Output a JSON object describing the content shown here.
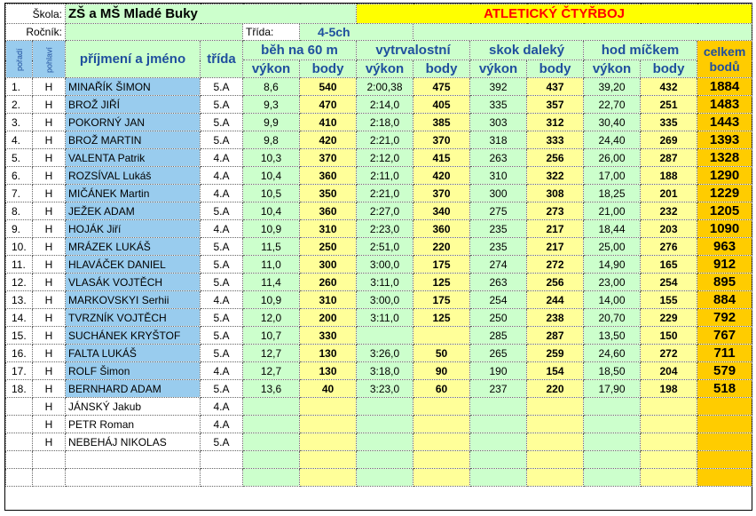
{
  "header": {
    "school_label": "Škola:",
    "school_value": "ZŠ a MŠ Mladé Buky",
    "title": "ATLETICKÝ ČTYŘBOJ",
    "grade_label": "Ročník:",
    "class_label": "Třída:",
    "class_value": "4-5ch"
  },
  "columns": {
    "rank": "pořadí",
    "gender": "pohlaví",
    "name": "příjmení a jméno",
    "class": "třída",
    "run60": "běh na 60 m",
    "endurance": "vytrvalostní",
    "longjump": "skok daleký",
    "throw": "hod míčkem",
    "total_line1": "celkem",
    "total_line2": "bodů",
    "performance": "výkon",
    "points": "body"
  },
  "rows": [
    {
      "rank": "1.",
      "gender": "H",
      "name": "MINAŘÍK ŠIMON",
      "class": "5.A",
      "run_perf": "8,6",
      "run_pts": "540",
      "end_perf": "2:00,38",
      "end_pts": "475",
      "jump_perf": "392",
      "jump_pts": "437",
      "throw_perf": "39,20",
      "throw_pts": "432",
      "total": "1884"
    },
    {
      "rank": "2.",
      "gender": "H",
      "name": "BROŽ JIŘÍ",
      "class": "5.A",
      "run_perf": "9,3",
      "run_pts": "470",
      "end_perf": "2:14,0",
      "end_pts": "405",
      "jump_perf": "335",
      "jump_pts": "357",
      "throw_perf": "22,70",
      "throw_pts": "251",
      "total": "1483"
    },
    {
      "rank": "3.",
      "gender": "H",
      "name": "POKORNÝ JAN",
      "class": "5.A",
      "run_perf": "9,9",
      "run_pts": "410",
      "end_perf": "2:18,0",
      "end_pts": "385",
      "jump_perf": "303",
      "jump_pts": "312",
      "throw_perf": "30,40",
      "throw_pts": "335",
      "total": "1443"
    },
    {
      "rank": "4.",
      "gender": "H",
      "name": "BROŽ MARTIN",
      "class": "5.A",
      "run_perf": "9,8",
      "run_pts": "420",
      "end_perf": "2:21,0",
      "end_pts": "370",
      "jump_perf": "318",
      "jump_pts": "333",
      "throw_perf": "24,40",
      "throw_pts": "269",
      "total": "1393"
    },
    {
      "rank": "5.",
      "gender": "H",
      "name": "VALENTA Patrik",
      "class": "4.A",
      "run_perf": "10,3",
      "run_pts": "370",
      "end_perf": "2:12,0",
      "end_pts": "415",
      "jump_perf": "263",
      "jump_pts": "256",
      "throw_perf": "26,00",
      "throw_pts": "287",
      "total": "1328"
    },
    {
      "rank": "6.",
      "gender": "H",
      "name": "ROZSÍVAL Lukáš",
      "class": "4.A",
      "run_perf": "10,4",
      "run_pts": "360",
      "end_perf": "2:11,0",
      "end_pts": "420",
      "jump_perf": "310",
      "jump_pts": "322",
      "throw_perf": "17,00",
      "throw_pts": "188",
      "total": "1290"
    },
    {
      "rank": "7.",
      "gender": "H",
      "name": "MIČÁNEK Martin",
      "class": "4.A",
      "run_perf": "10,5",
      "run_pts": "350",
      "end_perf": "2:21,0",
      "end_pts": "370",
      "jump_perf": "300",
      "jump_pts": "308",
      "throw_perf": "18,25",
      "throw_pts": "201",
      "total": "1229"
    },
    {
      "rank": "8.",
      "gender": "H",
      "name": "JEŽEK ADAM",
      "class": "5.A",
      "run_perf": "10,4",
      "run_pts": "360",
      "end_perf": "2:27,0",
      "end_pts": "340",
      "jump_perf": "275",
      "jump_pts": "273",
      "throw_perf": "21,00",
      "throw_pts": "232",
      "total": "1205"
    },
    {
      "rank": "9.",
      "gender": "H",
      "name": "HOJÁK Jiří",
      "class": "4.A",
      "run_perf": "10,9",
      "run_pts": "310",
      "end_perf": "2:23,0",
      "end_pts": "360",
      "jump_perf": "235",
      "jump_pts": "217",
      "throw_perf": "18,44",
      "throw_pts": "203",
      "total": "1090"
    },
    {
      "rank": "10.",
      "gender": "H",
      "name": "MRÁZEK LUKÁŠ",
      "class": "5.A",
      "run_perf": "11,5",
      "run_pts": "250",
      "end_perf": "2:51,0",
      "end_pts": "220",
      "jump_perf": "235",
      "jump_pts": "217",
      "throw_perf": "25,00",
      "throw_pts": "276",
      "total": "963"
    },
    {
      "rank": "11.",
      "gender": "H",
      "name": "HLAVÁČEK DANIEL",
      "class": "5.A",
      "run_perf": "11,0",
      "run_pts": "300",
      "end_perf": "3:00,0",
      "end_pts": "175",
      "jump_perf": "274",
      "jump_pts": "272",
      "throw_perf": "14,90",
      "throw_pts": "165",
      "total": "912"
    },
    {
      "rank": "12.",
      "gender": "H",
      "name": "VLASÁK VOJTĚCH",
      "class": "5.A",
      "run_perf": "11,4",
      "run_pts": "260",
      "end_perf": "3:11,0",
      "end_pts": "125",
      "jump_perf": "263",
      "jump_pts": "256",
      "throw_perf": "23,00",
      "throw_pts": "254",
      "total": "895"
    },
    {
      "rank": "13.",
      "gender": "H",
      "name": "MARKOVSKYI Serhii",
      "class": "4.A",
      "run_perf": "10,9",
      "run_pts": "310",
      "end_perf": "3:00,0",
      "end_pts": "175",
      "jump_perf": "254",
      "jump_pts": "244",
      "throw_perf": "14,00",
      "throw_pts": "155",
      "total": "884"
    },
    {
      "rank": "14.",
      "gender": "H",
      "name": "TVRZNÍK VOJTĚCH",
      "class": "5.A",
      "run_perf": "12,0",
      "run_pts": "200",
      "end_perf": "3:11,0",
      "end_pts": "125",
      "jump_perf": "250",
      "jump_pts": "238",
      "throw_perf": "20,70",
      "throw_pts": "229",
      "total": "792"
    },
    {
      "rank": "15.",
      "gender": "H",
      "name": "SUCHÁNEK KRYŠTOF",
      "class": "5.A",
      "run_perf": "10,7",
      "run_pts": "330",
      "end_perf": "",
      "end_pts": "",
      "jump_perf": "285",
      "jump_pts": "287",
      "throw_perf": "13,50",
      "throw_pts": "150",
      "total": "767"
    },
    {
      "rank": "16.",
      "gender": "H",
      "name": "FALTA LUKÁŠ",
      "class": "5.A",
      "run_perf": "12,7",
      "run_pts": "130",
      "end_perf": "3:26,0",
      "end_pts": "50",
      "jump_perf": "265",
      "jump_pts": "259",
      "throw_perf": "24,60",
      "throw_pts": "272",
      "total": "711"
    },
    {
      "rank": "17.",
      "gender": "H",
      "name": "ROLF Šimon",
      "class": "4.A",
      "run_perf": "12,7",
      "run_pts": "130",
      "end_perf": "3:18,0",
      "end_pts": "90",
      "jump_perf": "190",
      "jump_pts": "154",
      "throw_perf": "18,50",
      "throw_pts": "204",
      "total": "579"
    },
    {
      "rank": "18.",
      "gender": "H",
      "name": "BERNHARD ADAM",
      "class": "5.A",
      "run_perf": "13,6",
      "run_pts": "40",
      "end_perf": "3:23,0",
      "end_pts": "60",
      "jump_perf": "237",
      "jump_pts": "220",
      "throw_perf": "17,90",
      "throw_pts": "198",
      "total": "518"
    },
    {
      "rank": "",
      "gender": "H",
      "name": "JÁNSKÝ Jakub",
      "class": "4.A",
      "run_perf": "",
      "run_pts": "",
      "end_perf": "",
      "end_pts": "",
      "jump_perf": "",
      "jump_pts": "",
      "throw_perf": "",
      "throw_pts": "",
      "total": ""
    },
    {
      "rank": "",
      "gender": "H",
      "name": "PETR Roman",
      "class": "4.A",
      "run_perf": "",
      "run_pts": "",
      "end_perf": "",
      "end_pts": "",
      "jump_perf": "",
      "jump_pts": "",
      "throw_perf": "",
      "throw_pts": "",
      "total": ""
    },
    {
      "rank": "",
      "gender": "H",
      "name": "NEBEHÁJ NIKOLAS",
      "class": "5.A",
      "run_perf": "",
      "run_pts": "",
      "end_perf": "",
      "end_pts": "",
      "jump_perf": "",
      "jump_pts": "",
      "throw_perf": "",
      "throw_pts": "",
      "total": ""
    },
    {
      "rank": "",
      "gender": "",
      "name": "",
      "class": "",
      "run_perf": "",
      "run_pts": "",
      "end_perf": "",
      "end_pts": "",
      "jump_perf": "",
      "jump_pts": "",
      "throw_perf": "",
      "throw_pts": "",
      "total": ""
    },
    {
      "rank": "",
      "gender": "",
      "name": "",
      "class": "",
      "run_perf": "",
      "run_pts": "",
      "end_perf": "",
      "end_pts": "",
      "jump_perf": "",
      "jump_pts": "",
      "throw_perf": "",
      "throw_pts": "",
      "total": ""
    }
  ]
}
